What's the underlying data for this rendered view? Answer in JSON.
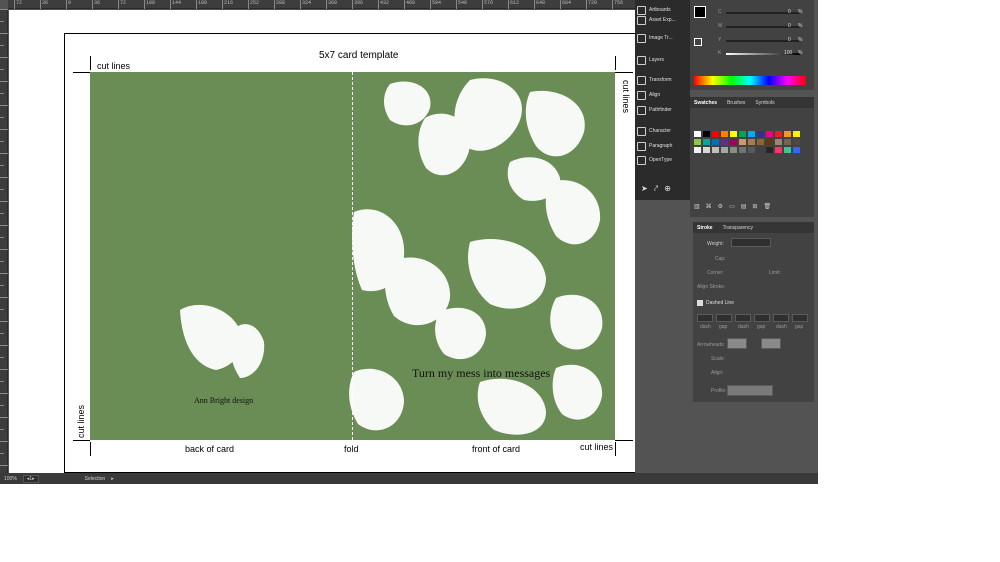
{
  "canvas": {
    "template_title": "5x7 card template",
    "cut_lines_top": "cut lines",
    "cut_lines_right": "cut lines",
    "cut_lines_left": "cut lines",
    "cut_lines_bottom": "cut lines",
    "back_label": "back of card",
    "fold_label": "fold",
    "front_label": "front of card",
    "card_color": "#6a8c55",
    "back_text": "Ann Bright design",
    "front_text": "Turn my mess into messages"
  },
  "ruler_labels": [
    "72",
    "36",
    "0",
    "36",
    "72",
    "108",
    "144",
    "180",
    "216",
    "252",
    "288",
    "324",
    "360",
    "396",
    "432",
    "468",
    "504",
    "540",
    "576",
    "612",
    "648",
    "684",
    "720",
    "756"
  ],
  "status": {
    "zoom": "100%",
    "artboard": "1",
    "tool": "Selection"
  },
  "panels_strip": [
    {
      "name": "artboards",
      "label": "Artboards"
    },
    {
      "name": "asset-export",
      "label": "Asset Exp..."
    },
    {
      "name": "image-trace",
      "label": "Image Tr..."
    },
    {
      "name": "layers",
      "label": "Layers"
    },
    {
      "name": "transform",
      "label": "Transform"
    },
    {
      "name": "align",
      "label": "Align"
    },
    {
      "name": "pathfinder",
      "label": "Pathfinder"
    },
    {
      "name": "character",
      "label": "Character"
    },
    {
      "name": "paragraph",
      "label": "Paragraph"
    },
    {
      "name": "opentype",
      "label": "OpenType"
    }
  ],
  "color": {
    "channels": [
      {
        "name": "C",
        "value": "0",
        "unit": "%"
      },
      {
        "name": "M",
        "value": "0",
        "unit": "%"
      },
      {
        "name": "Y",
        "value": "0",
        "unit": "%"
      },
      {
        "name": "K",
        "value": "100",
        "unit": "%"
      }
    ]
  },
  "swatches": {
    "tabs": [
      "Swatches",
      "Brushes",
      "Symbols"
    ],
    "colors": [
      "#ffffff",
      "#000000",
      "#ff0000",
      "#ff7f00",
      "#ffff00",
      "#00a651",
      "#00aeef",
      "#2e3192",
      "#ec008c",
      "#ed1c24",
      "#f7941d",
      "#fff200",
      "#8dc63f",
      "#00a99d",
      "#0072bc",
      "#662d91",
      "#9e005d",
      "#c69c6d",
      "#a67c52",
      "#8c6239",
      "#603913",
      "#998675",
      "#736357",
      "#534741",
      "#f2f2f2",
      "#d9d9d9",
      "#bfbfbf",
      "#a6a6a6",
      "#8c8c8c",
      "#737373",
      "#595959",
      "#404040",
      "#262626",
      "#ff3366",
      "#33cc99",
      "#3366ff"
    ]
  },
  "stroke": {
    "tabs": [
      "Stroke",
      "Transparency"
    ],
    "weight_label": "Weight:",
    "cap_label": "Cap:",
    "corner_label": "Corner:",
    "limit_label": "Limit:",
    "align_label": "Align Stroke:",
    "dashed_label": "Dashed Line",
    "dash_fields": [
      "dash",
      "gap",
      "dash",
      "gap",
      "dash",
      "gap"
    ],
    "arrowheads_label": "Arrowheads:",
    "scale_label": "Scale:",
    "align2_label": "Align:",
    "profile_label": "Profile:"
  }
}
